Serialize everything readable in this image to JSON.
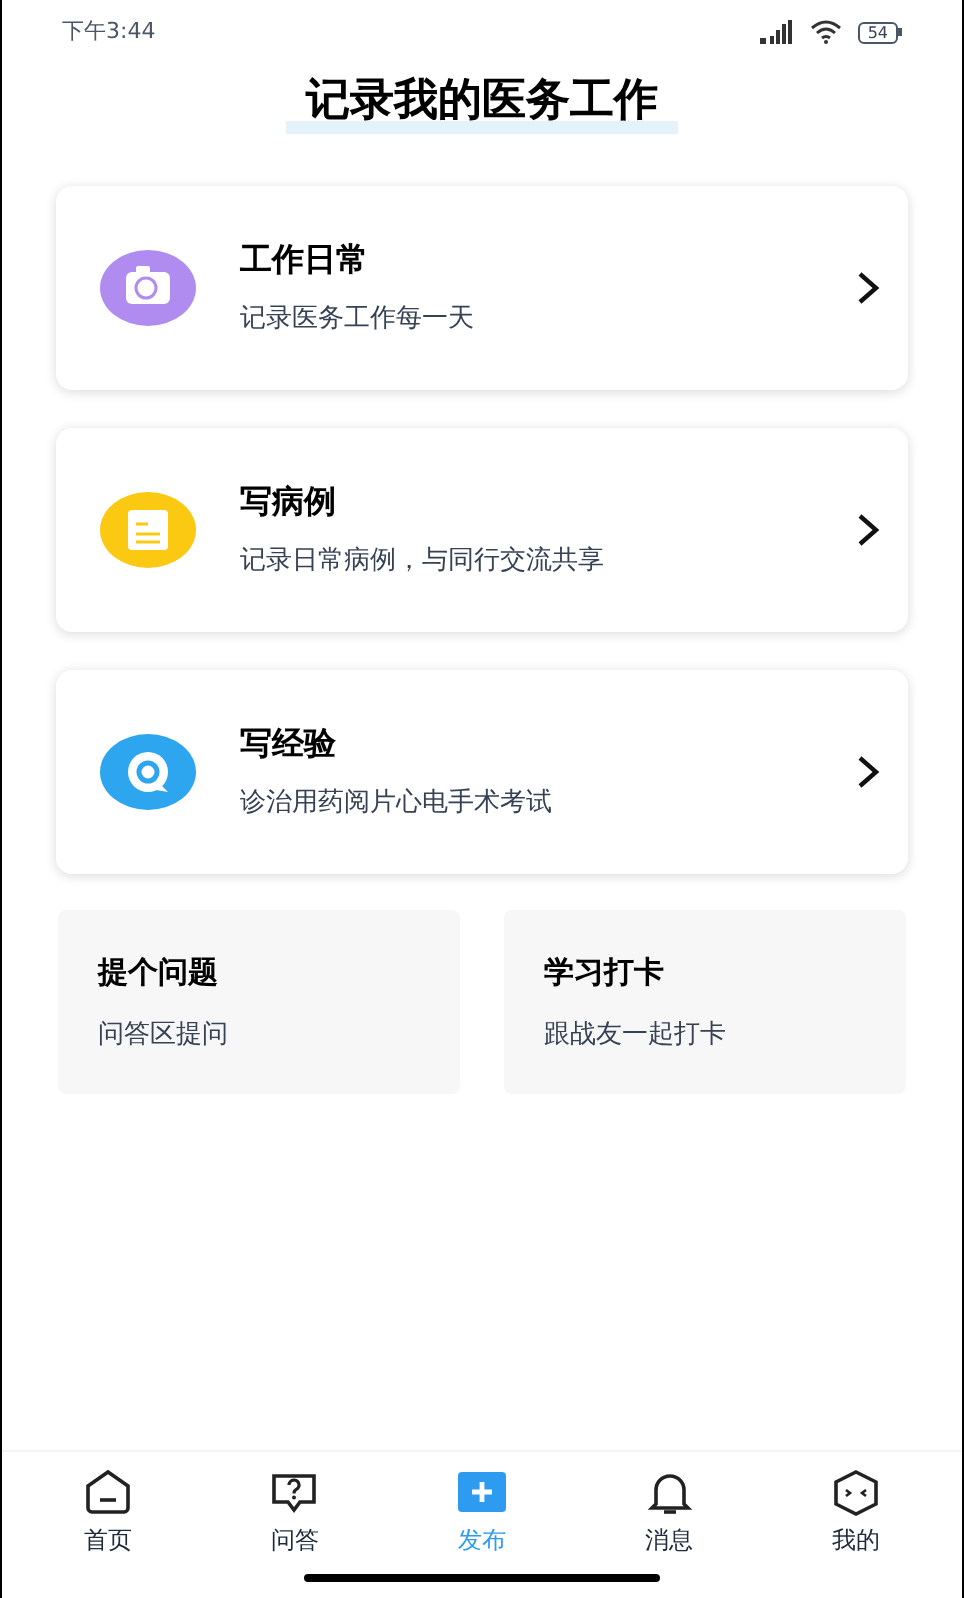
{
  "status_bar": {
    "time": "下午3:44",
    "battery": "54"
  },
  "title": "记录我的医务工作",
  "cards": [
    {
      "kind": "camera",
      "color": "#b18cf0",
      "title": "工作日常",
      "subtitle": "记录医务工作每一天"
    },
    {
      "kind": "note",
      "color": "#fbc812",
      "title": "写病例",
      "subtitle": "记录日常病例，与同行交流共享"
    },
    {
      "kind": "chat",
      "color": "#2ea6ef",
      "title": "写经验",
      "subtitle": "诊治用药阅片心电手术考试"
    }
  ],
  "small_cards": [
    {
      "title": "提个问题",
      "subtitle": "问答区提问"
    },
    {
      "title": "学习打卡",
      "subtitle": "跟战友一起打卡"
    }
  ],
  "tabs": [
    {
      "kind": "home",
      "label": "首页",
      "selected": false
    },
    {
      "kind": "question",
      "label": "问答",
      "selected": false
    },
    {
      "kind": "plus",
      "label": "发布",
      "selected": true
    },
    {
      "kind": "bell",
      "label": "消息",
      "selected": false
    },
    {
      "kind": "face",
      "label": "我的",
      "selected": false
    }
  ]
}
